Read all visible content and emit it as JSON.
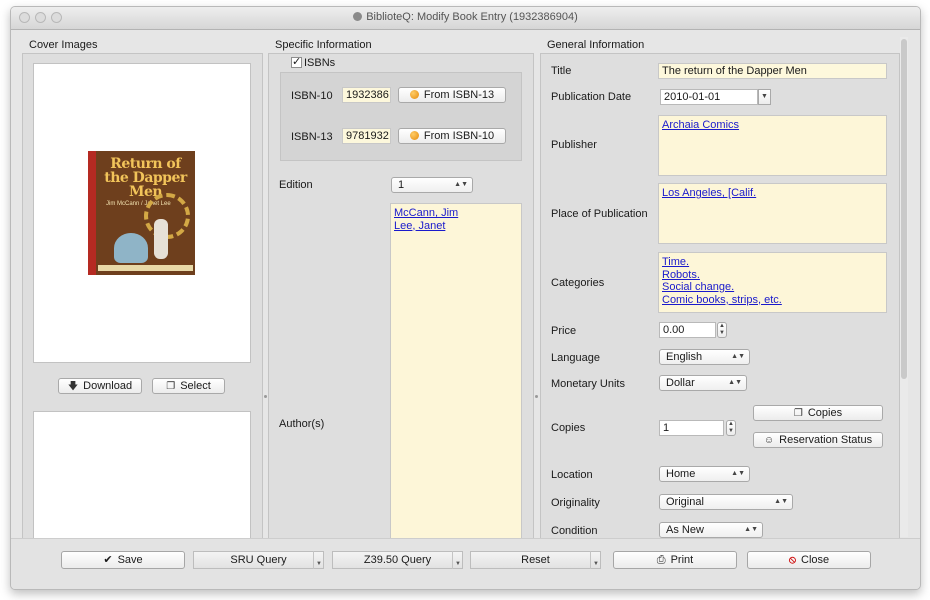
{
  "window": {
    "title": "BiblioteQ: Modify Book Entry (1932386904)"
  },
  "cover": {
    "section_title": "Cover Images",
    "art_title": "Return of the Dapper Men",
    "art_authors": "Jim McCann / Janet Lee",
    "download_label": "Download",
    "select_label": "Select"
  },
  "specific": {
    "section_title": "Specific Information",
    "isbns_label": "ISBNs",
    "isbns_checked": true,
    "isbn10_label": "ISBN-10",
    "isbn10_value": "1932386",
    "from_isbn13_label": "From ISBN-13",
    "isbn13_label": "ISBN-13",
    "isbn13_value": "9781932",
    "from_isbn10_label": "From ISBN-10",
    "edition_label": "Edition",
    "edition_value": "1",
    "authors_label": "Author(s)",
    "authors": [
      "McCann, Jim",
      "Lee, Janet"
    ]
  },
  "general": {
    "section_title": "General Information",
    "title_label": "Title",
    "title_value": "The return of the Dapper Men",
    "pubdate_label": "Publication Date",
    "pubdate_value": "2010-01-01",
    "publisher_label": "Publisher",
    "publisher_value": "Archaia Comics",
    "place_label": "Place of Publication",
    "place_value": "Los Angeles, [Calif.",
    "categories_label": "Categories",
    "categories": [
      "Time.",
      "Robots.",
      "Social change.",
      "Comic books, strips, etc."
    ],
    "price_label": "Price",
    "price_value": "0.00",
    "language_label": "Language",
    "language_value": "English",
    "monetary_label": "Monetary Units",
    "monetary_value": "Dollar",
    "copies_label": "Copies",
    "copies_value": "1",
    "copies_button": "Copies",
    "reservation_button": "Reservation Status",
    "location_label": "Location",
    "location_value": "Home",
    "originality_label": "Originality",
    "originality_value": "Original",
    "condition_label": "Condition",
    "condition_value": "As New"
  },
  "bottom": {
    "save": "Save",
    "sru": "SRU Query",
    "z3950": "Z39.50 Query",
    "reset": "Reset",
    "print": "Print",
    "close": "Close"
  }
}
